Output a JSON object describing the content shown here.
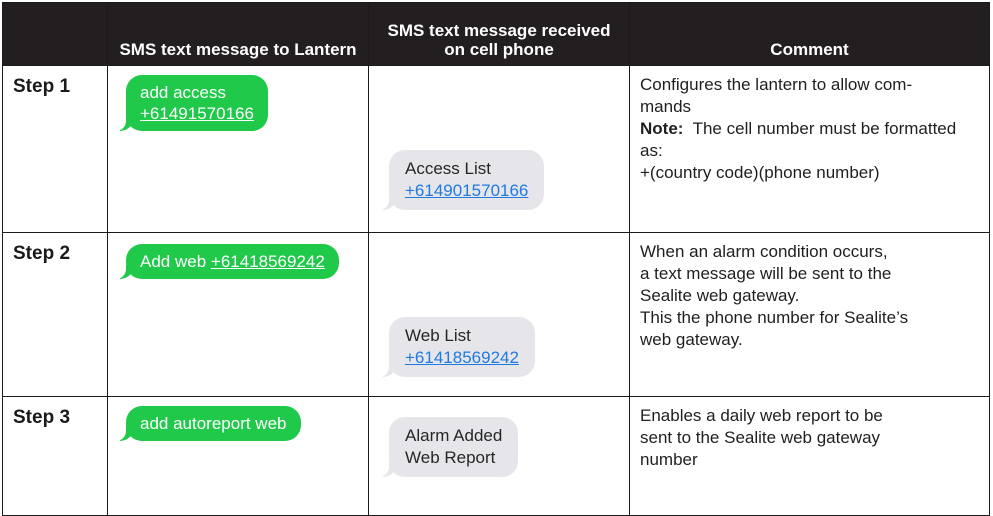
{
  "headers": {
    "step": "",
    "to_lantern": "SMS text message to Lantern",
    "received": "SMS text message received on cell phone",
    "comment": "Comment"
  },
  "rows": [
    {
      "step": "Step 1",
      "sent": {
        "text": "add access",
        "number": "+61491570166"
      },
      "received": {
        "text": "Access List",
        "number": "+614901570166"
      },
      "comment": {
        "line1": "Configures the lantern to allow com-",
        "line2": "mands",
        "note_label": "Note:",
        "note_text": "The cell number must be formatted as:",
        "line4": "+(country code)(phone number)"
      }
    },
    {
      "step": "Step 2",
      "sent": {
        "text": "Add web",
        "number": "+61418569242"
      },
      "received": {
        "text": "Web List",
        "number": "+61418569242"
      },
      "comment": {
        "line1": "When an alarm condition occurs,",
        "line2": "a text message will be sent to the",
        "line3": "Sealite web gateway.",
        "line4": "This the phone number for Sealite’s",
        "line5": "web gateway."
      }
    },
    {
      "step": "Step 3",
      "sent": {
        "text": "add autoreport web"
      },
      "received": {
        "line1": "Alarm Added",
        "line2": "Web Report"
      },
      "comment": {
        "line1": "Enables a daily web report to be",
        "line2": "sent to the Sealite web gateway",
        "line3": "number"
      }
    }
  ],
  "colors": {
    "header_bg": "#231f20",
    "sent_bubble": "#20c94a",
    "received_bubble": "#e6e6ea",
    "link_blue": "#1f7ae0"
  }
}
